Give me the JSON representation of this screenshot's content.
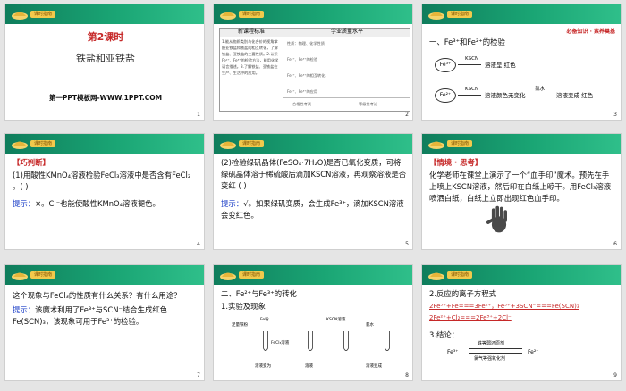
{
  "header_tag": "课时指南",
  "slides": [
    {
      "number": "1",
      "lesson": "第2课时",
      "title": "铁盐和亚铁盐",
      "footer": "第一PPT模板网-WWW.1PPT.COM"
    },
    {
      "number": "2",
      "col_left": "新课程标准",
      "col_right": "学业质量水平",
      "standards": "1.能从物质类别与化合价的视角掌握亚铁盐和铁盐的相互转化，了解铁盐、亚铁盐的主要性质。2.认识Fe²⁺、Fe³⁺的检验方法，能用化学语言描述。3.了解铁盐、亚铁盐在生产、生活中的应用。",
      "levels": [
        "合格性考试",
        "等级性考试"
      ],
      "rows": [
        "性质：物理、化学性质",
        "Fe²⁺、Fe³⁺的检验",
        "Fe²⁺、Fe³⁺的相互转化",
        "Fe²⁺、Fe³⁺的应用"
      ]
    },
    {
      "number": "3",
      "banner": "必备知识 · 素养奠基",
      "heading": "一、Fe³⁺和Fe²⁺的检验",
      "ion1": "Fe³⁺",
      "reagent1": "KSCN",
      "result1": "溶液呈 红色",
      "ion2": "Fe²⁺",
      "reagent2": "KSCN",
      "result2a": "溶液颜色无变化",
      "reagent3": "氯水",
      "result2b": "溶液变成 红色"
    },
    {
      "number": "4",
      "tag": "【巧判断】",
      "q": "(1)用酸性KMnO₄溶液检验FeCl₃溶液中是否含有FeCl₂ 。(    )",
      "hint_label": "提示：",
      "hint": "×。Cl⁻也能使酸性KMnO₄溶液褪色。"
    },
    {
      "number": "5",
      "q": "(2)检验绿矾晶体(FeSO₄·7H₂O)是否已氧化变质，可将绿矾晶体溶于稀硫酸后滴加KSCN溶液，再观察溶液是否变红 (    )",
      "hint_label": "提示：",
      "hint": "√。如果绿矾变质，会生成Fe³⁺，滴加KSCN溶液会变红色。"
    },
    {
      "number": "6",
      "tag": "【情境 · 思考】",
      "text": "化学老师在课堂上演示了一个“血手印”魔术。预先在手上喷上KSCN溶液，然后印在白纸上晾干。用FeCl₃溶液喷洒白纸，白纸上立即出现红色血手印。"
    },
    {
      "number": "7",
      "q": "这个现象与FeCl₃的性质有什么关系？有什么用途？",
      "hint_label": "提示：",
      "hint": "该魔术利用了Fe³⁺与SCN⁻结合生成红色Fe(SCN)₃，该现象可用于Fe³⁺的检验。"
    },
    {
      "number": "8",
      "heading": "二、Fe²⁺与Fe³⁺的转化",
      "sub": "1.实验及现象",
      "labels": [
        "Fe粉",
        "足量铁粉",
        "FeCl₃溶液",
        "溶液变为",
        "KSCN溶液",
        "溶液",
        "氯水",
        "溶液变成"
      ]
    },
    {
      "number": "9",
      "sub2": "2.反应的离子方程式",
      "eq1": "2Fe³⁺+Fe===3Fe²⁺，Fe³⁺+3SCN⁻===Fe(SCN)₃",
      "eq2": "2Fe²⁺+Cl₂===2Fe³⁺+2Cl⁻",
      "sub3": "3.结论：",
      "c_fe3": "Fe³⁺",
      "c_top": "铁等弱还原剂",
      "c_bottom": "氯气等强氧化剂",
      "c_fe2": "Fe²⁺"
    }
  ]
}
